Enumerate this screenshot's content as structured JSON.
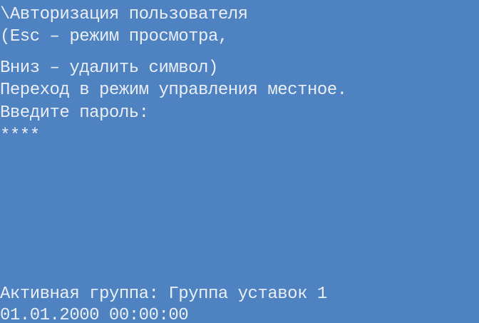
{
  "display": {
    "background_color": "#4f82c0",
    "text_color": "#e9eef7",
    "title": "\\Авторизация пользователя",
    "hint_line1": "(Esc – режим просмотра,",
    "hint_line2": "Вниз – удалить символ)",
    "message": "Переход в режим управления местное.",
    "password_prompt": "Введите пароль:",
    "password_value": "****",
    "active_group": "Активная группа: Группа уставок 1",
    "datetime": "01.01.2000 00:00:00"
  }
}
